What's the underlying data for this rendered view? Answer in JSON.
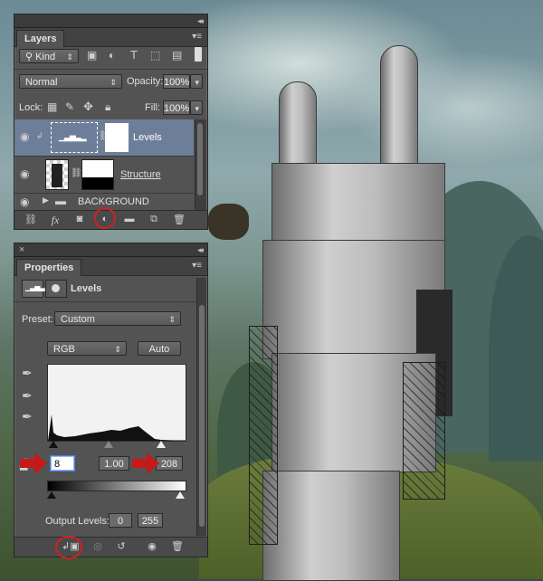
{
  "layers_panel": {
    "title": "Layers",
    "filter_label": "Kind",
    "blend_mode": "Normal",
    "opacity_label": "Opacity:",
    "opacity_value": "100%",
    "lock_label": "Lock:",
    "fill_label": "Fill:",
    "fill_value": "100%",
    "layers": [
      {
        "name": "Levels"
      },
      {
        "name": "Structure"
      },
      {
        "name": "BACKGROUND"
      }
    ],
    "bottom_icons": [
      "link-icon",
      "fx-icon",
      "mask-icon",
      "adjustment-icon",
      "folder-icon",
      "new-layer-icon",
      "trash-icon"
    ]
  },
  "properties_panel": {
    "title": "Properties",
    "header_label": "Levels",
    "preset_label": "Preset:",
    "preset_value": "Custom",
    "channel_value": "RGB",
    "auto_label": "Auto",
    "input_black": "8",
    "input_mid": "1.00",
    "input_white": "208",
    "output_label": "Output Levels:",
    "output_black": "0",
    "output_white": "255",
    "bottom_icons": [
      "clip-icon",
      "eye-view-icon",
      "reset-icon",
      "visibility-icon",
      "trash-icon"
    ]
  },
  "colors": {
    "panel": "#535353",
    "accent_red": "#d42020",
    "selected_layer": "#6d7f98"
  }
}
